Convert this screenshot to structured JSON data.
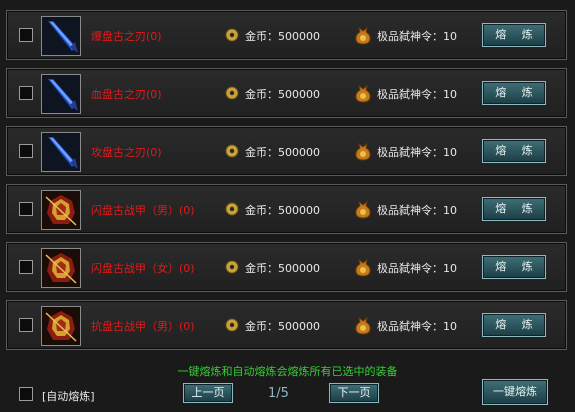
{
  "items": [
    {
      "name": "爆盘古之刃",
      "count": "(0)",
      "gold": "金币：500000",
      "token": "极品弑神令：10",
      "button": "熔 炼",
      "icon": "blue-blade-icon"
    },
    {
      "name": "血盘古之刃",
      "count": "(0)",
      "gold": "金币：500000",
      "token": "极品弑神令：10",
      "button": "熔 炼",
      "icon": "blue-blade-icon"
    },
    {
      "name": "攻盘古之刃",
      "count": "(0)",
      "gold": "金币：500000",
      "token": "极品弑神令：10",
      "button": "熔 炼",
      "icon": "blue-blade-icon"
    },
    {
      "name": "闪盘古战甲（男）",
      "count": "(0)",
      "gold": "金币：500000",
      "token": "极品弑神令：10",
      "button": "熔 炼",
      "icon": "red-armor-icon"
    },
    {
      "name": "闪盘古战甲（女）",
      "count": "(0)",
      "gold": "金币：500000",
      "token": "极品弑神令：10",
      "button": "熔 炼",
      "icon": "red-armor-icon"
    },
    {
      "name": "抗盘古战甲（男）",
      "count": "(0)",
      "gold": "金币：500000",
      "token": "极品弑神令：10",
      "button": "熔 炼",
      "icon": "red-armor-icon"
    }
  ],
  "footer": {
    "hint": "一键熔炼和自动熔炼会熔炼所有已选中的装备",
    "auto_label": "[自动熔炼]",
    "prev": "上一页",
    "page": "1/5",
    "next": "下一页",
    "smelt_all": "一键熔炼"
  },
  "colors": {
    "item_name": "#e21a1a",
    "hint": "#35d035",
    "button": "#2d5a63"
  }
}
